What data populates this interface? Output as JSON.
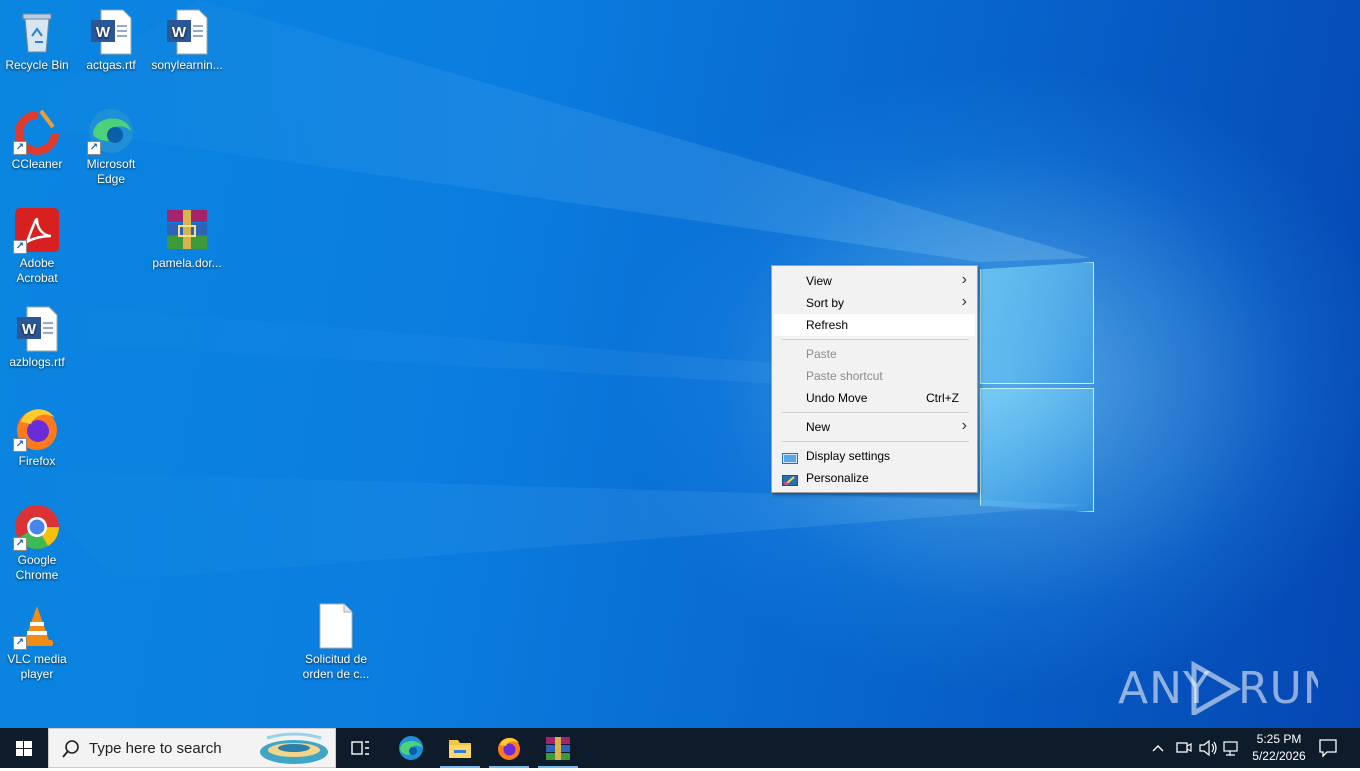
{
  "desktop_icons": [
    {
      "label": "Recycle Bin",
      "icon": "recycle-bin-icon"
    },
    {
      "label": "actgas.rtf",
      "icon": "word-doc-icon"
    },
    {
      "label": "sonylearnin...",
      "icon": "word-doc-icon"
    },
    {
      "label": "CCleaner",
      "icon": "ccleaner-icon"
    },
    {
      "label": "Microsoft Edge",
      "icon": "edge-icon"
    },
    {
      "label": "Adobe Acrobat",
      "icon": "acrobat-icon"
    },
    {
      "label": "pamela.dor...",
      "icon": "winrar-archive-icon"
    },
    {
      "label": "azblogs.rtf",
      "icon": "word-doc-icon"
    },
    {
      "label": "Firefox",
      "icon": "firefox-icon"
    },
    {
      "label": "Google Chrome",
      "icon": "chrome-icon"
    },
    {
      "label": "VLC media player",
      "icon": "vlc-icon"
    },
    {
      "label": "Solicitud de orden de c...",
      "icon": "blank-file-icon"
    }
  ],
  "context_menu": {
    "view": "View",
    "sort_by": "Sort by",
    "refresh": "Refresh",
    "paste": "Paste",
    "paste_shortcut": "Paste shortcut",
    "undo_move": "Undo Move",
    "undo_move_shortcut": "Ctrl+Z",
    "new": "New",
    "display_settings": "Display settings",
    "personalize": "Personalize"
  },
  "taskbar": {
    "search_placeholder": "Type here to search",
    "time": "5:25 PM",
    "date": "5/22/2026",
    "pinned": [
      "task-view-icon",
      "edge-icon",
      "file-explorer-icon",
      "firefox-icon",
      "winrar-icon"
    ]
  },
  "watermark": "ANY RUN",
  "colors": {
    "desktop_blue": "#0b7de0",
    "taskbar": "#0d1b2a",
    "menu_bg": "#f2f2f2"
  }
}
